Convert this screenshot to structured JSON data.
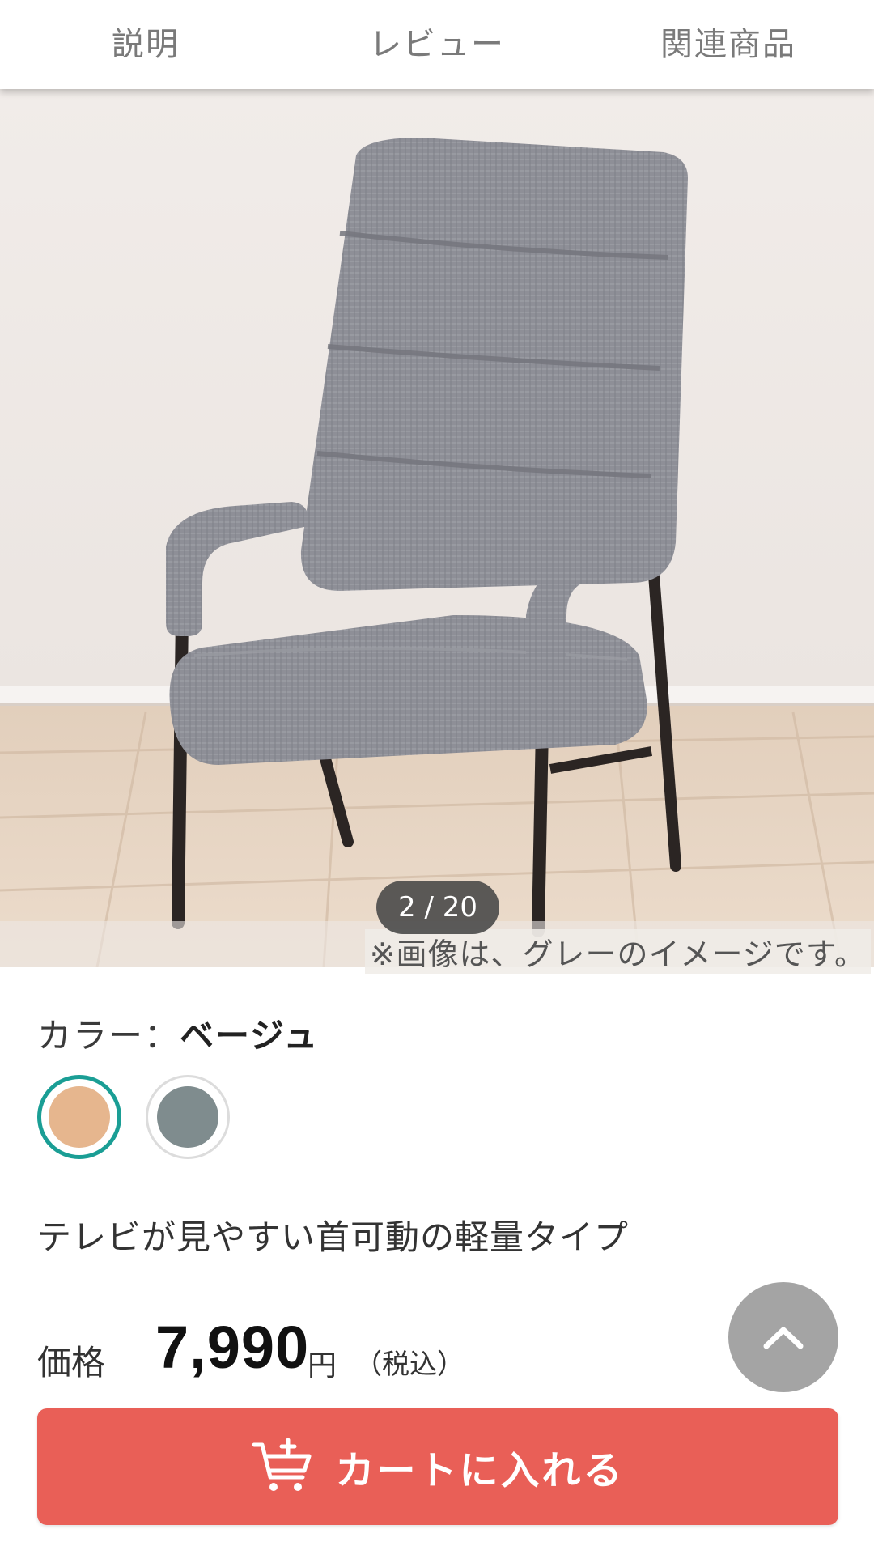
{
  "tabs": [
    {
      "label": "説明"
    },
    {
      "label": "レビュー"
    },
    {
      "label": "関連商品"
    }
  ],
  "gallery": {
    "counter": "2 / 20",
    "caption": "※画像は、グレーのイメージです。"
  },
  "color": {
    "label": "カラー：",
    "selected": "ベージュ",
    "swatches": [
      {
        "name": "beige",
        "color": "#e6b68e",
        "selected": true
      },
      {
        "name": "gray",
        "color": "#7f8c8e",
        "selected": false
      }
    ]
  },
  "product": {
    "tagline": "テレビが見やすい首可動の軽量タイプ"
  },
  "price": {
    "label": "価格",
    "value": "7,990",
    "unit": "円",
    "tax": "（税込）"
  },
  "cart": {
    "label": "カートに入れる",
    "color": "#e95f57"
  },
  "icons": {
    "back_to_top": "chevron-up-icon",
    "cart": "cart-plus-icon"
  }
}
